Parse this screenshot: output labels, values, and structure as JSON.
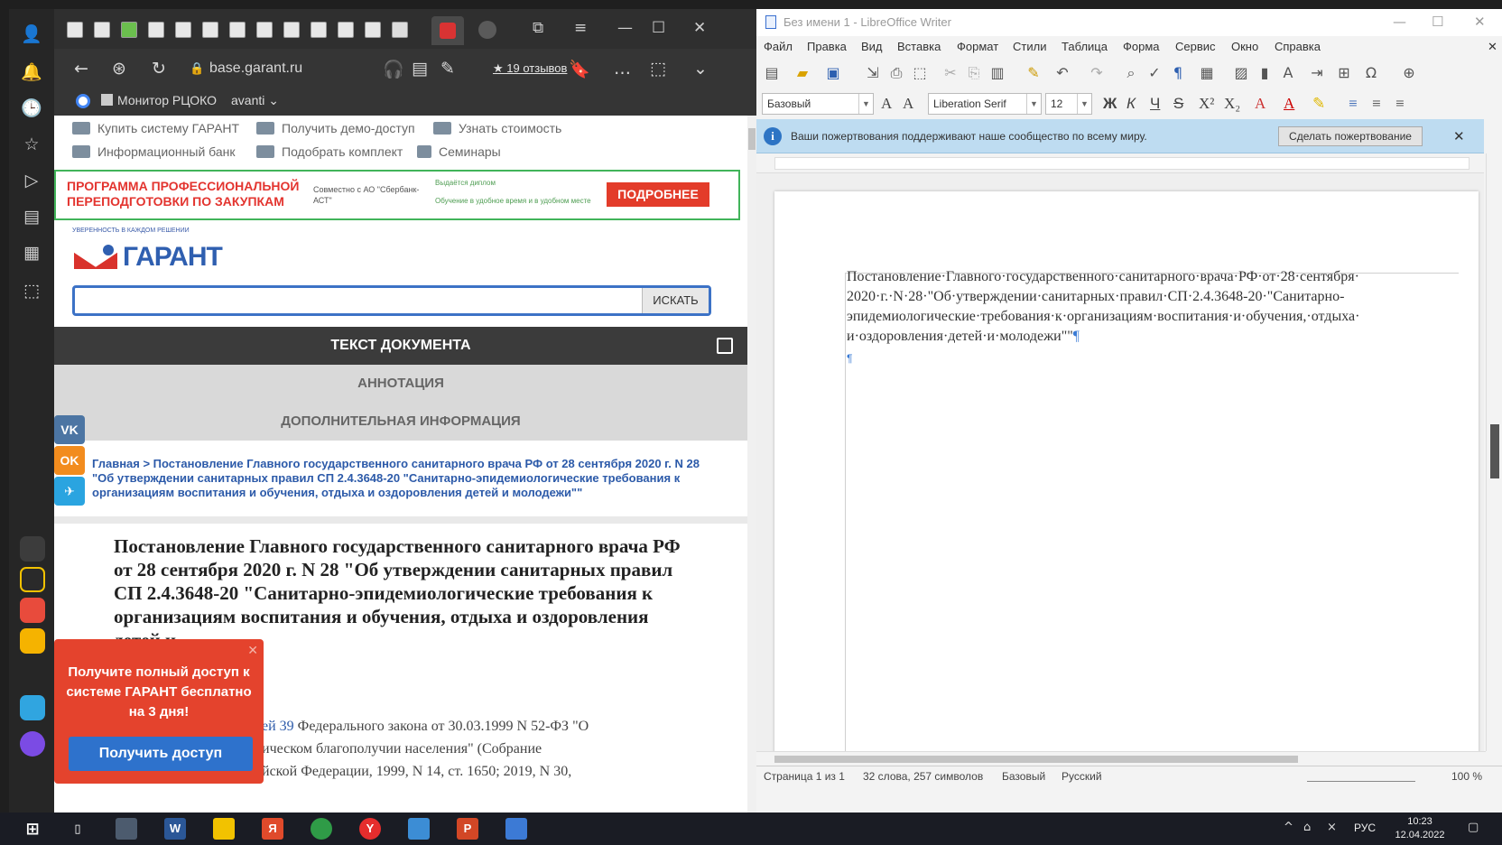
{
  "browser": {
    "address": "base.garant.ru",
    "reviews": "★ 19 отзывов",
    "bookmarks": [
      "Монитор РЦОКО",
      "avanti ⌄"
    ],
    "topnav": [
      "Купить систему ГАРАНТ",
      "Получить демо-доступ",
      "Узнать стоимость",
      "Информационный банк",
      "Подобрать комплект",
      "Семинары"
    ],
    "promo": {
      "title": "ПРОГРАММА ПРОФЕССИОНАЛЬНОЙ ПЕРЕПОДГОТОВКИ ПО ЗАКУПКАМ",
      "with": "Совместно с АО \"Сбербанк-АСТ\"",
      "feature1": "Выдаётся диплом",
      "feature2": "Обучение в удобное время и в удобном месте",
      "button": "ПОДРОБНЕЕ"
    },
    "brand": {
      "tagline": "УВЕРЕННОСТЬ В КАЖДОМ РЕШЕНИИ",
      "logo": "ГАРАНТ"
    },
    "search": {
      "button": "ИСКАТЬ",
      "value": ""
    },
    "tabs": {
      "doc_text": "ТЕКСТ ДОКУМЕНТА",
      "annotation": "АННОТАЦИЯ",
      "additional": "ДОПОЛНИТЕЛЬНАЯ ИНФОРМАЦИЯ"
    },
    "breadcrumb": "Главная > Постановление Главного государственного санитарного врача РФ от 28 сентября 2020 г. N 28 \"Об утверждении санитарных правил СП 2.4.3648-20 \"Санитарно-эпидемиологические требования к организациям воспитания и обучения, отдыха и оздоровления детей и молодежи\"\"",
    "doc_title": "Постановление Главного государственного санитарного врача РФ от 28 сентября 2020 г. N 28 \"Об утверждении санитарных правил СП 2.4.3648-20 \"Санитарно-эпидемиологические требования к организациям воспитания и обучения, отдыха и оздоровления детей и",
    "doc_body_link": "ей 39",
    "doc_body_l1": " Федерального закона от 30.03.1999 N 52-ФЗ \"О",
    "doc_body_l2": "ическом благополучии населения\" (Собрание",
    "doc_body_l3": "йской Федерации, 1999, N 14, ст. 1650; 2019, N 30,",
    "popup": {
      "text": "Получите полный доступ к системе ГАРАНТ бесплатно на 3 дня!",
      "button": "Получить доступ"
    },
    "social": [
      "VK",
      "OK",
      "✈"
    ]
  },
  "writer": {
    "title": "Без имени 1 - LibreOffice Writer",
    "menu": [
      "Файл",
      "Правка",
      "Вид",
      "Вставка",
      "Формат",
      "Стили",
      "Таблица",
      "Форма",
      "Сервис",
      "Окно",
      "Справка"
    ],
    "style_combo": "Базовый",
    "font_combo": "Liberation Serif",
    "size_combo": "12",
    "infobar_text": "Ваши пожертвования поддерживают наше сообщество по всему миру.",
    "donate_button": "Сделать пожертвование",
    "paragraph_lines": [
      "Постановление·Главного·государственного·санитарного·врача·РФ·от·28·сентября·",
      "2020·г.·N·28·\"Об·утверждении·санитарных·правил·СП·2.4.3648-20·\"Санитарно-",
      "эпидемиологические·требования·к·организациям·воспитания·и·обучения,·отдыха·",
      "и·оздоровления·детей·и·молодежи\"\""
    ],
    "status": {
      "page": "Страница 1 из 1",
      "words": "32 слова, 257 символов",
      "style": "Базовый",
      "lang": "Русский",
      "zoom": "100 %"
    }
  },
  "taskbar": {
    "lang": "РУС",
    "time": "10:23",
    "date": "12.04.2022"
  },
  "colors": {
    "garant_red": "#e3342f",
    "garant_blue": "#2f5fb0",
    "promo_green": "#41b45a",
    "infobar": "#bedcf1"
  }
}
